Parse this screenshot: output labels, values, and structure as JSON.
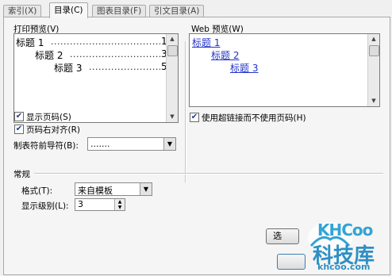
{
  "tabs": [
    {
      "label": "索引(X)"
    },
    {
      "label": "目录(C)"
    },
    {
      "label": "图表目录(F)"
    },
    {
      "label": "引文目录(A)"
    }
  ],
  "print_preview": {
    "label": "打印预览(V)",
    "entries": [
      {
        "text": "标题 1",
        "page": "1"
      },
      {
        "text": "标题 2",
        "page": "3"
      },
      {
        "text": "标题 3",
        "page": "5"
      }
    ]
  },
  "web_preview": {
    "label": "Web 预览(W)",
    "entries": [
      "标题 1",
      "标题 2",
      "标题 3"
    ]
  },
  "options": {
    "show_page_numbers": {
      "label": "显示页码(S)",
      "checked": true
    },
    "right_align": {
      "label": "页码右对齐(R)",
      "checked": true
    },
    "tab_leader": {
      "label": "制表符前导符(B):",
      "value": "......."
    },
    "use_hyperlinks": {
      "label": "使用超链接而不使用页码(H)",
      "checked": true
    }
  },
  "general": {
    "title": "常规",
    "format": {
      "label": "格式(T):",
      "value": "来自模板"
    },
    "levels": {
      "label": "显示级别(L):",
      "value": "3"
    }
  },
  "buttons": {
    "options_partial": "选"
  },
  "watermark": {
    "brand": "KHCoo",
    "cn": "科技库",
    "url": "khcoo.com"
  }
}
